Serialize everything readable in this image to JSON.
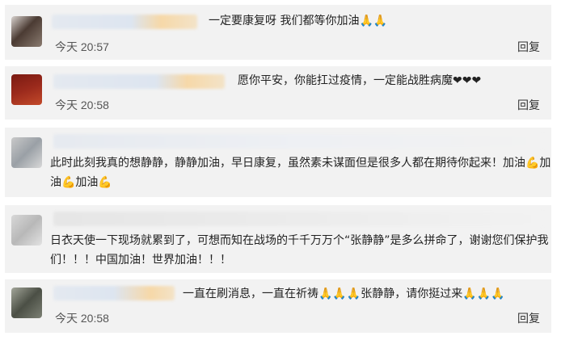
{
  "comments": [
    {
      "text": "一定要康复呀 我们都等你加油🙏🙏",
      "time": "今天 20:57",
      "reply_label": "回复",
      "avatar_colors": [
        "#4b3b33",
        "#8a7b70"
      ],
      "name_colors": [
        "#dde5f0",
        "#f6d8a8"
      ]
    },
    {
      "text": "愿你平安，你能扛过疫情，一定能战胜病魔❤❤❤",
      "time": "今天 20:58",
      "reply_label": "回复",
      "avatar_colors": [
        "#9b2a1c",
        "#c34a2a"
      ],
      "name_colors": [
        "#dde5f0",
        "#f6d8a8"
      ]
    },
    {
      "text": "此时此刻我真的想静静，静静加油，早日康复，虽然素未谋面但是很多人都在期待你起来！加油💪加油💪加油💪",
      "avatar_colors": [
        "#9aa0a6",
        "#c9c9c9"
      ],
      "name_colors": [
        "#e6eaf0",
        "#f2f2f2"
      ]
    },
    {
      "text": "日衣天使一下现场就累到了，可想而知在战场的千千万万个“张静静”是多么拼命了，谢谢您们保护我们！！！中国加油！世界加油！！！",
      "avatar_colors": [
        "#b8b8b8",
        "#d8d8d8"
      ],
      "name_colors": [
        "#e6e6e6",
        "#f2f2f2"
      ]
    },
    {
      "text": "一直在刷消息，一直在祈祷🙏🙏🙏张静静，请你挺过来🙏🙏🙏",
      "time": "今天 20:58",
      "reply_label": "回复",
      "avatar_colors": [
        "#4b4f45",
        "#a3a69a"
      ],
      "name_colors": [
        "#dde5f0",
        "#f6d8a8"
      ]
    }
  ]
}
